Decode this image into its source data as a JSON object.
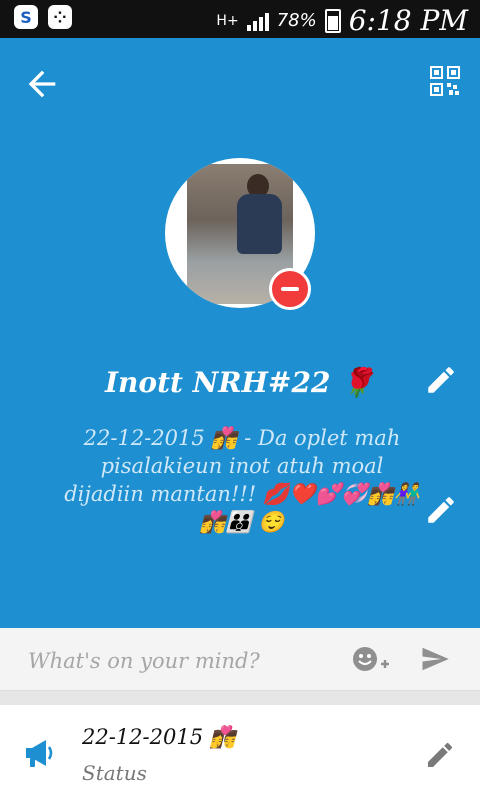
{
  "status_bar": {
    "network": "H+",
    "battery": "78%",
    "time": "6:18 PM"
  },
  "profile": {
    "name": "Inott NRH#22 🌹",
    "status_message": "22-12-2015 👩‍❤️‍💋‍👨 - Da oplet mah pisalakieun inot atuh moal dijadiin mantan!!! 💋❤️💕💞👩‍❤️‍💋‍👨👫👩‍❤️‍💋‍👨👪 😌"
  },
  "compose": {
    "placeholder": "What's on your mind?"
  },
  "status_card": {
    "date": "22-12-2015 👩‍❤️‍💋‍👨",
    "label": "Status"
  },
  "colors": {
    "primary": "#1e8fd0",
    "accent": "#f23b3b"
  }
}
